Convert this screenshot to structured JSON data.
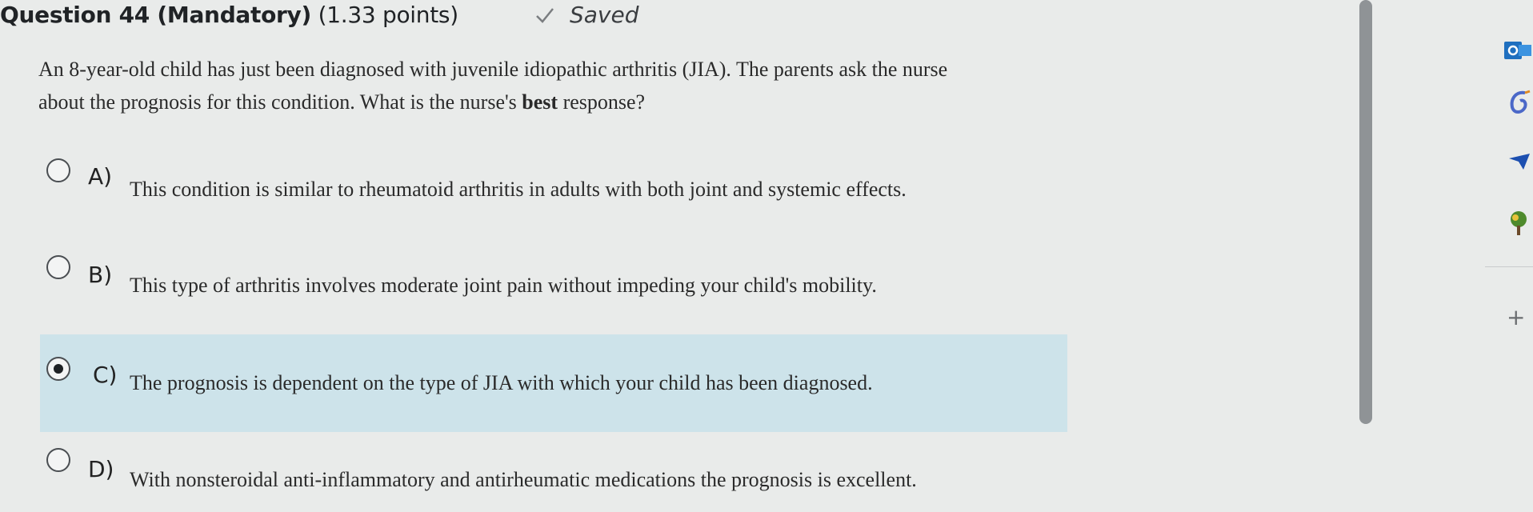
{
  "header": {
    "title_strong": "Question 44 (Mandatory)",
    "title_points": "(1.33 points)",
    "saved_label": "Saved"
  },
  "question": {
    "stem_part1": "An 8-year-old child has just been diagnosed with juvenile idiopathic arthritis (JIA). The parents ask the nurse",
    "stem_part2": "about the prognosis for this condition. What is the nurse's ",
    "stem_bold": "best",
    "stem_part3": " response?"
  },
  "options": [
    {
      "letter": "A)",
      "text": "This condition is similar to rheumatoid arthritis in adults with both joint and systemic effects.",
      "selected": false
    },
    {
      "letter": "B)",
      "text": "This type of arthritis involves moderate joint pain without impeding your child's mobility.",
      "selected": false
    },
    {
      "letter": "C)",
      "text": "The prognosis is dependent on the type of JIA with which your child has been diagnosed.",
      "selected": true
    },
    {
      "letter": "D)",
      "text": "With nonsteroidal anti-inflammatory and antirheumatic medications the prognosis is excellent.",
      "selected": false
    }
  ],
  "sidebar": {
    "plus_label": "+"
  },
  "colors": {
    "selected_bg": "#cde3ea",
    "page_bg": "#e9ebea",
    "check": "#7a7d80"
  }
}
